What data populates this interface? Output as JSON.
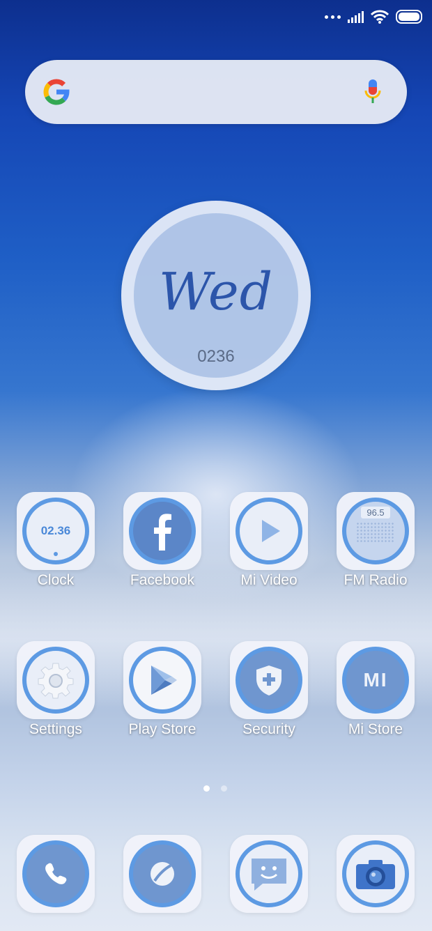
{
  "status_bar": {
    "icons": [
      "more-dots-icon",
      "signal-icon",
      "wifi-icon",
      "battery-icon"
    ]
  },
  "search": {
    "logo": "google-logo-icon",
    "mic": "mic-icon"
  },
  "clock_widget": {
    "day": "Wed",
    "time": "0236"
  },
  "apps": [
    {
      "label": "Clock",
      "icon": "clock-icon",
      "value": "02.36"
    },
    {
      "label": "Facebook",
      "icon": "facebook-icon"
    },
    {
      "label": "Mi Video",
      "icon": "play-video-icon"
    },
    {
      "label": "FM Radio",
      "icon": "radio-icon",
      "value": "96.5"
    },
    {
      "label": "Settings",
      "icon": "gear-icon"
    },
    {
      "label": "Play Store",
      "icon": "play-store-icon"
    },
    {
      "label": "Security",
      "icon": "shield-icon"
    },
    {
      "label": "Mi Store",
      "icon": "mi-store-icon",
      "value": "MI"
    }
  ],
  "pager": {
    "pages": 2,
    "current": 1
  },
  "dock": [
    {
      "icon": "phone-icon"
    },
    {
      "icon": "browser-icon"
    },
    {
      "icon": "messages-icon"
    },
    {
      "icon": "camera-icon"
    }
  ],
  "colors": {
    "accent": "#5d9ae3",
    "tile": "#f0f3fa",
    "day_text": "#2c55aa"
  }
}
